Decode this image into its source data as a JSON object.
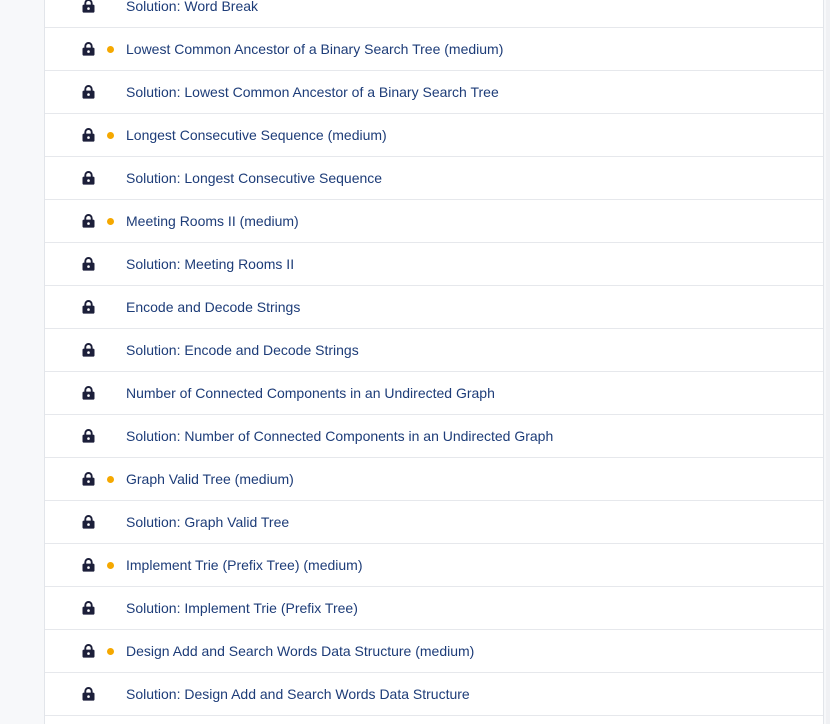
{
  "lessons": [
    {
      "title": "Solution: Word Break",
      "locked": true,
      "medium": false
    },
    {
      "title": "Lowest Common Ancestor of a Binary Search Tree (medium)",
      "locked": true,
      "medium": true
    },
    {
      "title": "Solution: Lowest Common Ancestor of a Binary Search Tree",
      "locked": true,
      "medium": false
    },
    {
      "title": "Longest Consecutive Sequence (medium)",
      "locked": true,
      "medium": true
    },
    {
      "title": "Solution: Longest Consecutive Sequence",
      "locked": true,
      "medium": false
    },
    {
      "title": "Meeting Rooms II (medium)",
      "locked": true,
      "medium": true
    },
    {
      "title": "Solution: Meeting Rooms II",
      "locked": true,
      "medium": false
    },
    {
      "title": "Encode and Decode Strings",
      "locked": true,
      "medium": false
    },
    {
      "title": "Solution: Encode and Decode Strings",
      "locked": true,
      "medium": false
    },
    {
      "title": "Number of Connected Components in an Undirected Graph",
      "locked": true,
      "medium": false
    },
    {
      "title": "Solution: Number of Connected Components in an Undirected Graph",
      "locked": true,
      "medium": false
    },
    {
      "title": "Graph Valid Tree (medium)",
      "locked": true,
      "medium": true
    },
    {
      "title": "Solution: Graph Valid Tree",
      "locked": true,
      "medium": false
    },
    {
      "title": "Implement Trie (Prefix Tree) (medium)",
      "locked": true,
      "medium": true
    },
    {
      "title": "Solution: Implement Trie (Prefix Tree)",
      "locked": true,
      "medium": false
    },
    {
      "title": "Design Add and Search Words Data Structure (medium)",
      "locked": true,
      "medium": true
    },
    {
      "title": "Solution: Design Add and Search Words Data Structure",
      "locked": true,
      "medium": false
    },
    {
      "title": "",
      "locked": false,
      "medium": false
    }
  ],
  "colors": {
    "title_text": "#1d3c78",
    "lock_icon": "#1c1f3a",
    "medium_dot": "#f5a800",
    "row_divider": "#e6e8ec"
  }
}
